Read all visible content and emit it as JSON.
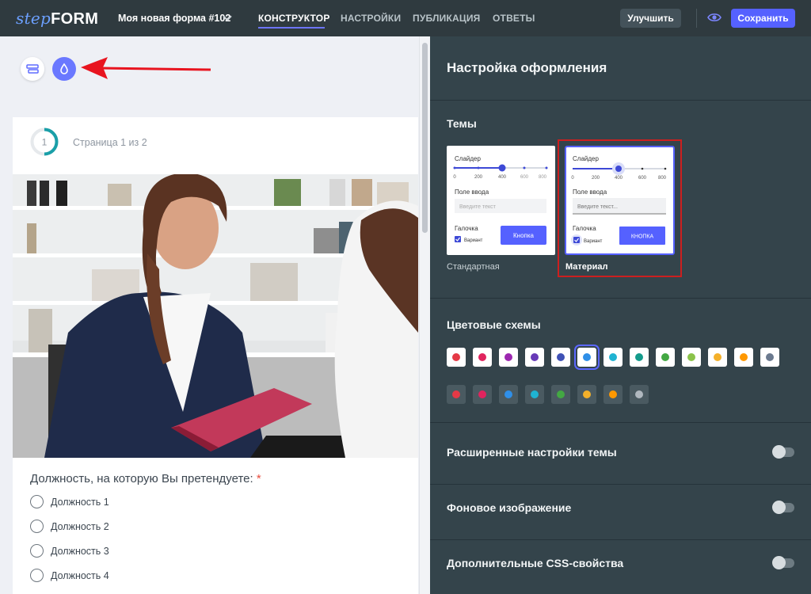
{
  "header": {
    "logo_step": "step",
    "logo_form": "FORM",
    "form_name": "Моя новая форма #102",
    "tabs": [
      {
        "label": "КОНСТРУКТОР",
        "active": true
      },
      {
        "label": "НАСТРОЙКИ",
        "active": false
      },
      {
        "label": "ПУБЛИКАЦИЯ",
        "active": false
      },
      {
        "label": "ОТВЕТЫ",
        "active": false
      }
    ],
    "improve_label": "Улучшить",
    "save_label": "Сохранить",
    "preview_icon": "eye-icon"
  },
  "toolbar": {
    "layout_icon": "layout-icon",
    "theme_icon": "drop-icon"
  },
  "form": {
    "page_number": "1",
    "page_label": "Страница 1 из 2",
    "question": "Должность, на которую Вы претендуете:",
    "required_mark": "*",
    "options": [
      "Должность 1",
      "Должность 2",
      "Должность 3",
      "Должность 4"
    ]
  },
  "panel": {
    "title": "Настройка оформления",
    "themes_title": "Темы",
    "themes": [
      {
        "caption": "Стандартная",
        "selected": false,
        "slider_label": "Слайдер",
        "ticks": [
          "0",
          "200",
          "400",
          "600",
          "800"
        ],
        "input_label": "Поле ввода",
        "input_placeholder": "Введите текст",
        "checkbox_label": "Галочка",
        "checkbox_option": "Вариант",
        "button_label": "Кнопка"
      },
      {
        "caption": "Материал",
        "selected": true,
        "slider_label": "Слайдер",
        "ticks": [
          "0",
          "200",
          "400",
          "600",
          "800"
        ],
        "input_label": "Поле ввода",
        "input_placeholder": "Введите текст...",
        "checkbox_label": "Галочка",
        "checkbox_option": "Вариант",
        "button_label": "КНОПКА"
      }
    ],
    "color_schemes_title": "Цветовые схемы",
    "light_schemes": [
      "#e53946",
      "#e0245e",
      "#9c27b0",
      "#673ab7",
      "#3f51b5",
      "#2f8fe8",
      "#1fb3d2",
      "#149b8c",
      "#43a843",
      "#8bc34a",
      "#f4b02a",
      "#ff9800",
      "#6b7a8f"
    ],
    "selected_scheme_index": 5,
    "dark_schemes": [
      "#e53946",
      "#e0245e",
      "#2f8fe8",
      "#1fb3d2",
      "#43a843",
      "#f4b02a",
      "#ff9800",
      "#b0b8bf"
    ],
    "toggles": [
      {
        "label": "Расширенные настройки темы",
        "on": false
      },
      {
        "label": "Фоновое изображение",
        "on": false
      },
      {
        "label": "Дополнительные CSS-свойства",
        "on": false
      }
    ]
  }
}
